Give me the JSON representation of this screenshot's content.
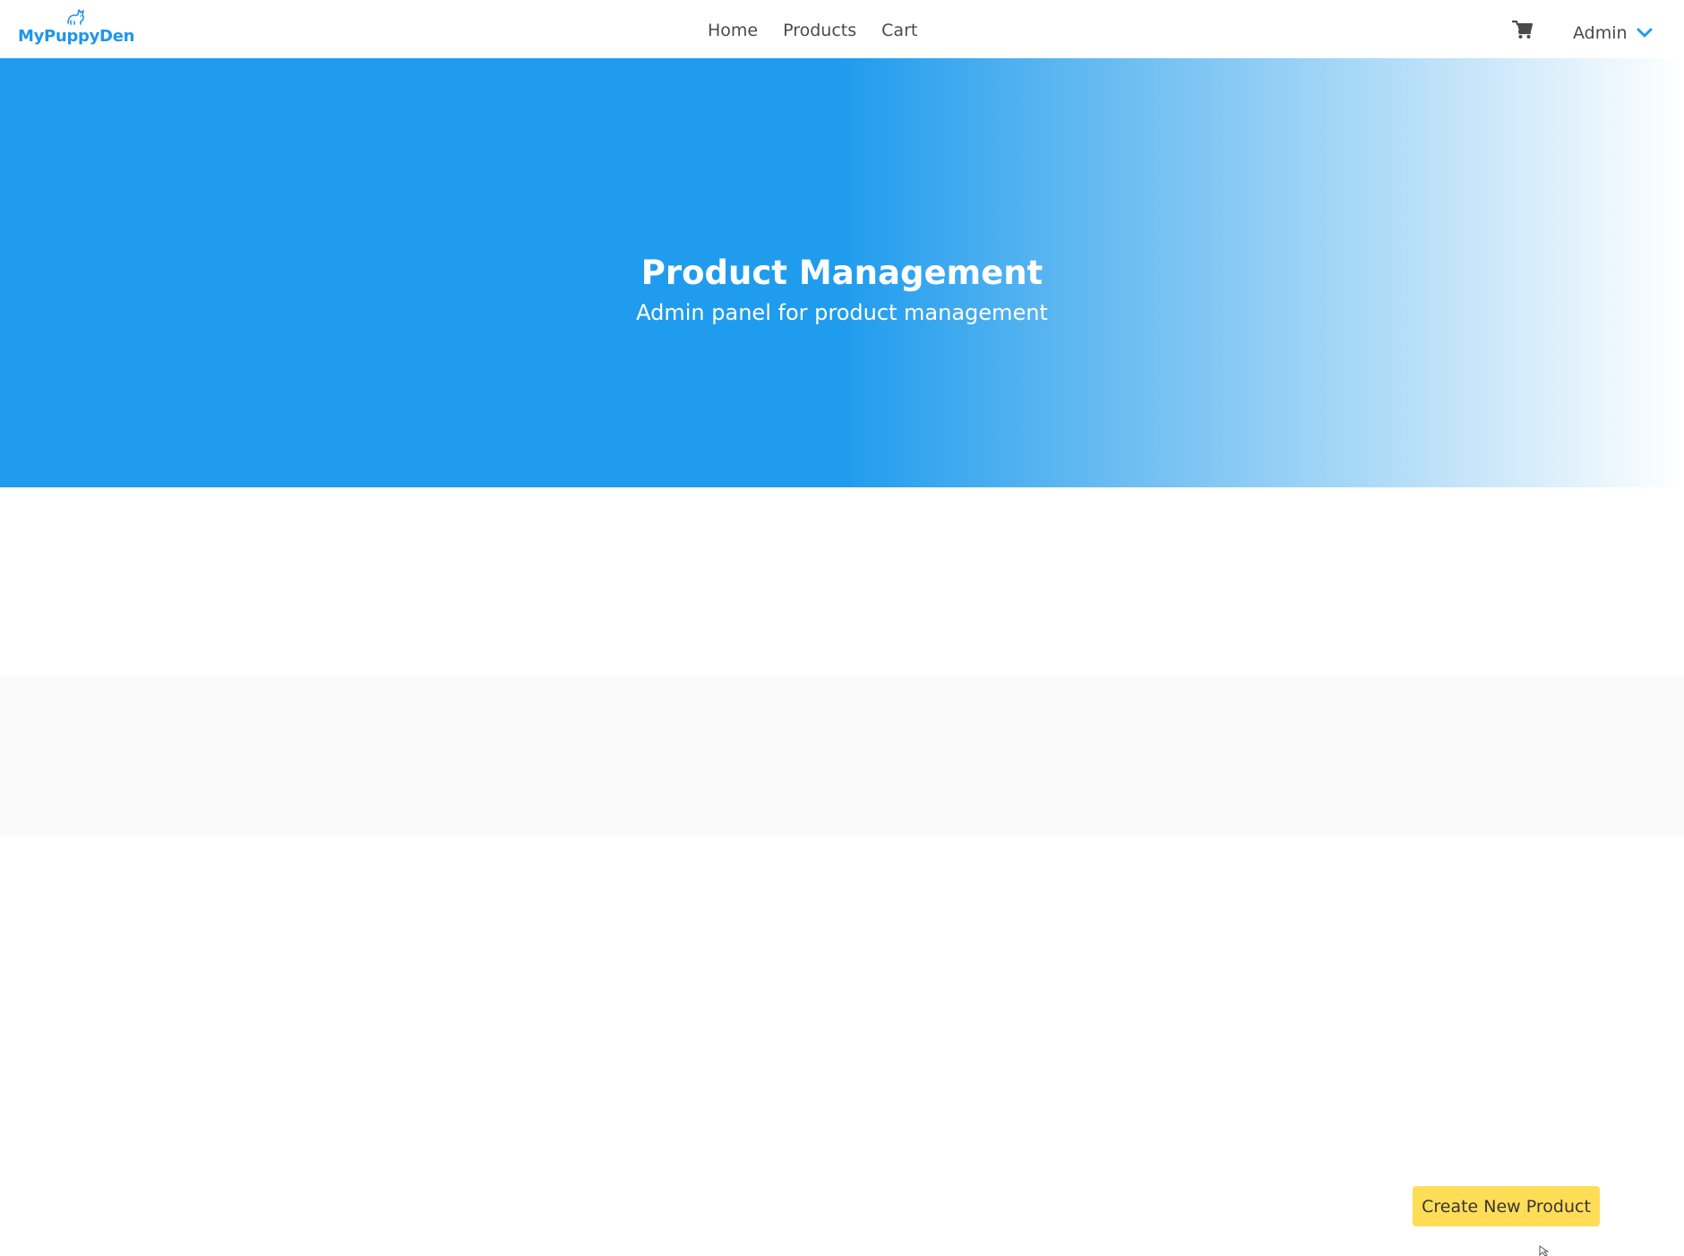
{
  "brand": {
    "name": "MyPuppyDen",
    "icon": "puppy-icon",
    "color": "#1e96ea"
  },
  "nav": {
    "links": [
      {
        "label": "Home"
      },
      {
        "label": "Products"
      },
      {
        "label": "Cart"
      }
    ],
    "cart_icon": "shopping-cart-icon",
    "user_menu_label": "Admin",
    "user_menu_icon": "chevron-down-icon"
  },
  "hero": {
    "title": "Product Management",
    "subtitle": "Admin panel for product management",
    "color": "#209cee"
  },
  "actions": {
    "create_label": "Create New Product",
    "create_color": "#ffdd57"
  }
}
